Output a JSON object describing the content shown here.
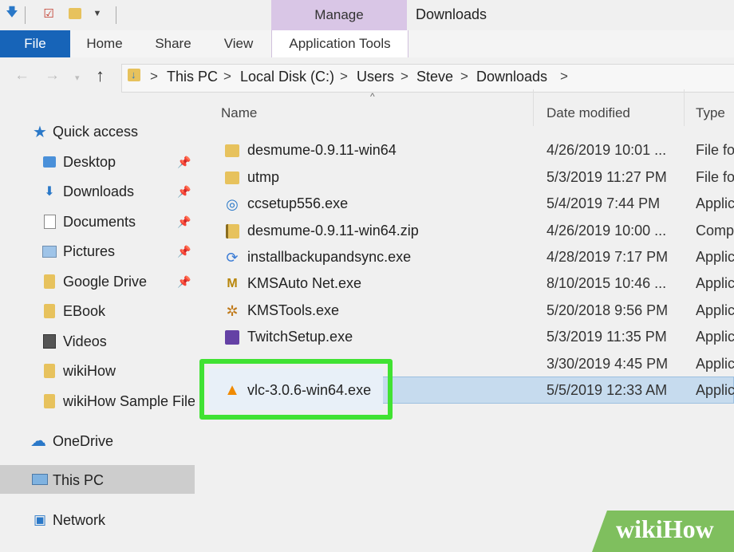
{
  "window": {
    "title": "Downloads",
    "context_tab": "Manage"
  },
  "ribbon": {
    "tabs": [
      "File",
      "Home",
      "Share",
      "View",
      "Application Tools"
    ]
  },
  "address": {
    "crumbs": [
      "This PC",
      "Local Disk (C:)",
      "Users",
      "Steve",
      "Downloads"
    ]
  },
  "columns": {
    "name": "Name",
    "date": "Date modified",
    "type": "Type"
  },
  "sidebar": {
    "quick_access": "Quick access",
    "items": [
      "Desktop",
      "Downloads",
      "Documents",
      "Pictures",
      "Google Drive",
      "EBook",
      "Videos",
      "wikiHow",
      "wikiHow Sample File"
    ],
    "onedrive": "OneDrive",
    "thispc": "This PC",
    "network": "Network"
  },
  "files": [
    {
      "name": "desmume-0.9.11-win64",
      "date": "4/26/2019 10:01 ...",
      "type": "File fo"
    },
    {
      "name": "utmp",
      "date": "5/3/2019 11:27 PM",
      "type": "File fo"
    },
    {
      "name": "ccsetup556.exe",
      "date": "5/4/2019 7:44 PM",
      "type": "Applic"
    },
    {
      "name": "desmume-0.9.11-win64.zip",
      "date": "4/26/2019 10:00 ...",
      "type": "Comp"
    },
    {
      "name": "installbackupandsync.exe",
      "date": "4/28/2019 7:17 PM",
      "type": "Applic"
    },
    {
      "name": "KMSAuto Net.exe",
      "date": "8/10/2015 10:46 ...",
      "type": "Applic"
    },
    {
      "name": "KMSTools.exe",
      "date": "5/20/2018 9:56 PM",
      "type": "Applic"
    },
    {
      "name": "TwitchSetup.exe",
      "date": "5/3/2019 11:35 PM",
      "type": "Applic"
    },
    {
      "name": "",
      "date": "3/30/2019 4:45 PM",
      "type": "Applic"
    },
    {
      "name": "vlc-3.0.6-win64.exe",
      "date": "5/5/2019 12:33 AM",
      "type": "Applic"
    }
  ],
  "watermark": {
    "text": "wikiHow"
  },
  "colors": {
    "file_tab": "#1764b8",
    "manage": "#d9c6e6",
    "selection": "#c6dbee",
    "highlight": "#41e232"
  }
}
